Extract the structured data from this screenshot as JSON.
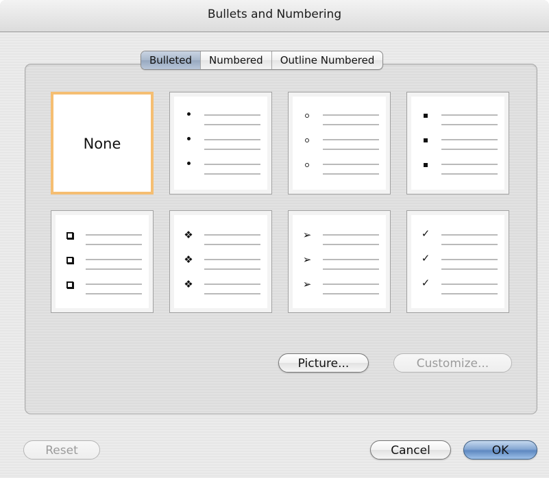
{
  "window": {
    "title": "Bullets and Numbering"
  },
  "tabs": [
    {
      "label": "Bulleted",
      "selected": true
    },
    {
      "label": "Numbered",
      "selected": false
    },
    {
      "label": "Outline Numbered",
      "selected": false
    }
  ],
  "gallery": {
    "none_label": "None",
    "selected_style": "none",
    "styles": [
      {
        "id": "none"
      },
      {
        "id": "filled-dot",
        "marker": "•"
      },
      {
        "id": "hollow-circle",
        "marker": "○"
      },
      {
        "id": "filled-square",
        "marker": "▪"
      },
      {
        "id": "hollow-square",
        "marker": "❑"
      },
      {
        "id": "four-diamonds",
        "marker": "❖"
      },
      {
        "id": "arrowhead",
        "marker": "➢"
      },
      {
        "id": "checkmark",
        "marker": "✓"
      }
    ]
  },
  "buttons": {
    "picture": "Picture...",
    "customize": "Customize...",
    "reset": "Reset",
    "cancel": "Cancel",
    "ok": "OK"
  },
  "colors": {
    "selected_border": "#f5be72",
    "default_button": "#6f95c9",
    "selected_tab": "#a9b8cc"
  }
}
